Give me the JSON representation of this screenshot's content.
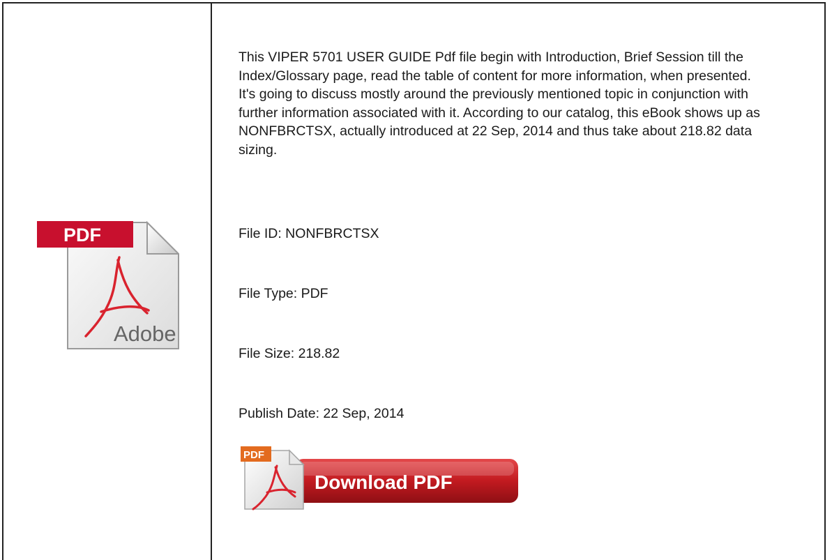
{
  "description": "This VIPER 5701 USER GUIDE Pdf file begin with Introduction, Brief Session till the Index/Glossary page, read the table of content for more information, when presented. It's going to discuss mostly around the previously mentioned topic in conjunction with further information associated with it. According to our catalog, this eBook shows up as NONFBRCTSX, actually introduced at 22 Sep, 2014 and thus take about 218.82 data sizing.",
  "meta": {
    "file_id": "File ID: NONFBRCTSX",
    "file_type": "File Type: PDF",
    "file_size": "File Size: 218.82",
    "publish_date": "Publish Date: 22 Sep, 2014"
  },
  "pdf_icon": {
    "tag": "PDF",
    "brand": "Adobe"
  },
  "download_button": {
    "tag": "PDF",
    "label": "Download PDF"
  },
  "colors": {
    "accent_red": "#c8102e",
    "button_red": "#b3141b",
    "border": "#222222"
  }
}
